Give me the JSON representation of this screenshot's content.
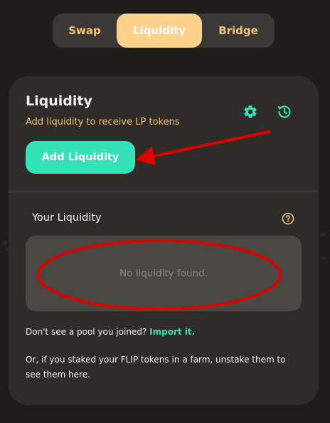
{
  "tabs": [
    {
      "label": "Swap",
      "active": false
    },
    {
      "label": "Liquidity",
      "active": true
    },
    {
      "label": "Bridge",
      "active": false
    }
  ],
  "card": {
    "title": "Liquidity",
    "subtitle": "Add liquidity to receive LP tokens",
    "settings_icon": "gear-icon",
    "history_icon": "history-icon",
    "add_button_label": "Add Liquidity"
  },
  "your_liquidity": {
    "heading": "Your Liquidity",
    "help_icon": "question-circle-icon",
    "empty_message": "No liquidity found."
  },
  "hints": {
    "pool_prompt": "Don't see a pool you joined?",
    "import_link": "Import it.",
    "staked_note": "Or, if you staked your FLIP tokens in a farm, unstake them to see them here."
  },
  "colors": {
    "background": "#1e1d1a",
    "card": "#2d2c28",
    "accent_mint": "#35e2b7",
    "accent_gold": "#f4c27a",
    "active_tab": "#fdd08b",
    "annotation_red": "#e00000"
  }
}
